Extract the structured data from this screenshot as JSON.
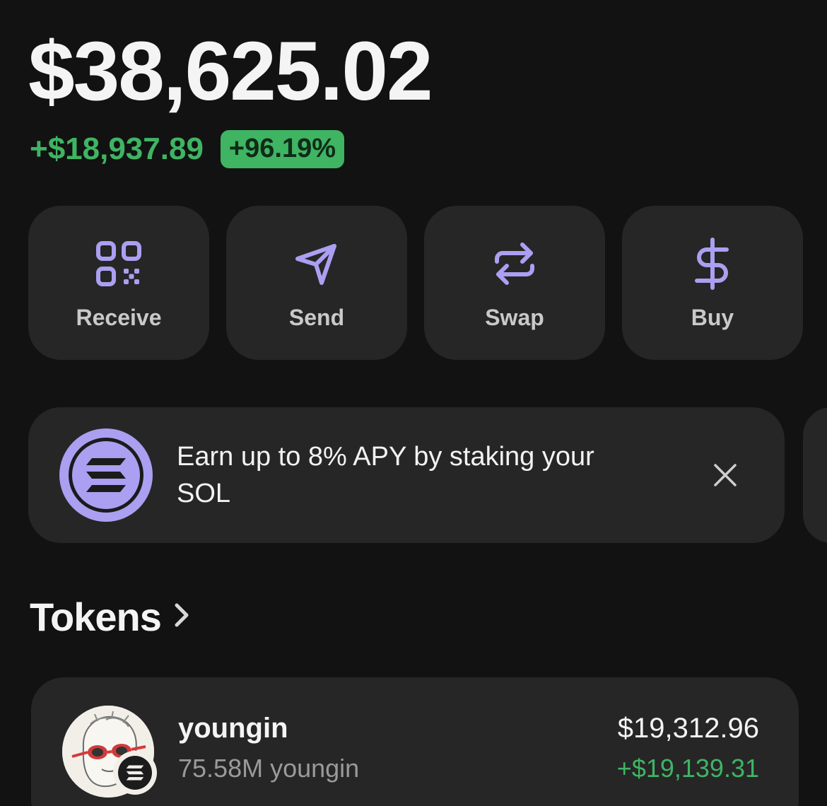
{
  "portfolio": {
    "balance": "$38,625.02",
    "change_amount": "+$18,937.89",
    "change_percent": "+96.19%"
  },
  "actions": [
    {
      "label": "Receive",
      "icon": "qr-code-icon"
    },
    {
      "label": "Send",
      "icon": "paper-plane-icon"
    },
    {
      "label": "Swap",
      "icon": "swap-arrows-icon"
    },
    {
      "label": "Buy",
      "icon": "dollar-icon"
    }
  ],
  "promo": {
    "text": "Earn up to 8% APY by staking your SOL",
    "icon": "solana-icon",
    "close_icon": "close-icon"
  },
  "tokens": {
    "title": "Tokens",
    "items": [
      {
        "name": "youngin",
        "amount": "75.58M youngin",
        "value": "$19,312.96",
        "change": "+$19,139.31",
        "chain_icon": "solana-icon"
      }
    ]
  },
  "colors": {
    "accent": "#ab9ff2",
    "positive": "#3fb463",
    "card": "#262626",
    "background": "#121212"
  }
}
